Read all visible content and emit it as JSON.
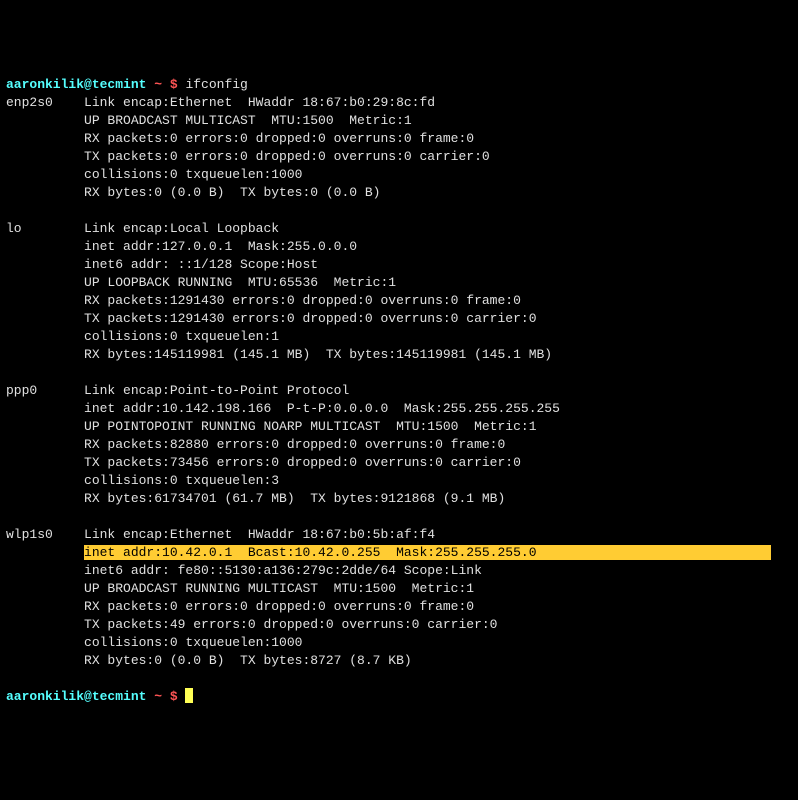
{
  "prompt": {
    "user_host": "aaronkilik@tecmint",
    "sep": " ~ $ ",
    "command": "ifconfig"
  },
  "enp2s0": {
    "name": "enp2s0",
    "l1": "Link encap:Ethernet  HWaddr 18:67:b0:29:8c:fd",
    "l2": "UP BROADCAST MULTICAST  MTU:1500  Metric:1",
    "l3": "RX packets:0 errors:0 dropped:0 overruns:0 frame:0",
    "l4": "TX packets:0 errors:0 dropped:0 overruns:0 carrier:0",
    "l5": "collisions:0 txqueuelen:1000",
    "l6": "RX bytes:0 (0.0 B)  TX bytes:0 (0.0 B)"
  },
  "lo": {
    "name": "lo",
    "l1": "Link encap:Local Loopback",
    "l2": "inet addr:127.0.0.1  Mask:255.0.0.0",
    "l3": "inet6 addr: ::1/128 Scope:Host",
    "l4": "UP LOOPBACK RUNNING  MTU:65536  Metric:1",
    "l5": "RX packets:1291430 errors:0 dropped:0 overruns:0 frame:0",
    "l6": "TX packets:1291430 errors:0 dropped:0 overruns:0 carrier:0",
    "l7": "collisions:0 txqueuelen:1",
    "l8": "RX bytes:145119981 (145.1 MB)  TX bytes:145119981 (145.1 MB)"
  },
  "ppp0": {
    "name": "ppp0",
    "l1": "Link encap:Point-to-Point Protocol",
    "l2": "inet addr:10.142.198.166  P-t-P:0.0.0.0  Mask:255.255.255.255",
    "l3": "UP POINTOPOINT RUNNING NOARP MULTICAST  MTU:1500  Metric:1",
    "l4": "RX packets:82880 errors:0 dropped:0 overruns:0 frame:0",
    "l5": "TX packets:73456 errors:0 dropped:0 overruns:0 carrier:0",
    "l6": "collisions:0 txqueuelen:3",
    "l7": "RX bytes:61734701 (61.7 MB)  TX bytes:9121868 (9.1 MB)"
  },
  "wlp1s0": {
    "name": "wlp1s0",
    "l1": "Link encap:Ethernet  HWaddr 18:67:b0:5b:af:f4",
    "hl_pre": "inet addr:10.42.0.1  Bcast:10.42.0.255  Mask:255.255.255.0",
    "l3": "inet6 addr: fe80::5130:a136:279c:2dde/64 Scope:Link",
    "l4": "UP BROADCAST RUNNING MULTICAST  MTU:1500  Metric:1",
    "l5": "RX packets:0 errors:0 dropped:0 overruns:0 frame:0",
    "l6": "TX packets:49 errors:0 dropped:0 overruns:0 carrier:0",
    "l7": "collisions:0 txqueuelen:1000",
    "l8": "RX bytes:0 (0.0 B)  TX bytes:8727 (8.7 KB)"
  },
  "indent": "          ",
  "iface_pad": {
    "enp2s0": "enp2s0    ",
    "lo": "lo        ",
    "ppp0": "ppp0      ",
    "wlp1s0": "wlp1s0    "
  }
}
